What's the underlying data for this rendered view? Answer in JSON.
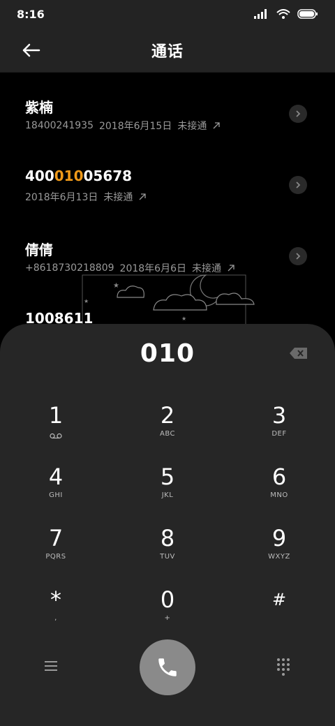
{
  "status": {
    "time": "8:16"
  },
  "header": {
    "title": "通话"
  },
  "calls": [
    {
      "name": "紫楠",
      "number": "18400241935",
      "date": "2018年6月15日",
      "status": "未接通"
    },
    {
      "name_pre": "400",
      "name_hl": "010",
      "name_post": "05678",
      "date": "2018年6月13日",
      "status": "未接通"
    },
    {
      "name": "倩倩",
      "number": "+8618730218809",
      "date": "2018年6月6日",
      "status": "未接通"
    },
    {
      "name": "1008611"
    }
  ],
  "dialpad": {
    "input": "010",
    "keys": [
      {
        "digit": "1",
        "letters": ""
      },
      {
        "digit": "2",
        "letters": "ABC"
      },
      {
        "digit": "3",
        "letters": "DEF"
      },
      {
        "digit": "4",
        "letters": "GHI"
      },
      {
        "digit": "5",
        "letters": "JKL"
      },
      {
        "digit": "6",
        "letters": "MNO"
      },
      {
        "digit": "7",
        "letters": "PQRS"
      },
      {
        "digit": "8",
        "letters": "TUV"
      },
      {
        "digit": "9",
        "letters": "WXYZ"
      },
      {
        "digit": "*",
        "letters": ","
      },
      {
        "digit": "0",
        "letters": "+"
      },
      {
        "digit": "#",
        "letters": ""
      }
    ]
  },
  "icons": {
    "back": "arrow-left-icon",
    "detail": "chevron-right-icon",
    "backspace": "backspace-icon",
    "voicemail": "voicemail-icon",
    "call": "phone-icon",
    "menu": "menu-icon",
    "dialpad": "dialpad-grid-icon"
  },
  "colors": {
    "highlight": "#f09a19",
    "call_button": "#8a8a8a",
    "panel": "#262626"
  }
}
